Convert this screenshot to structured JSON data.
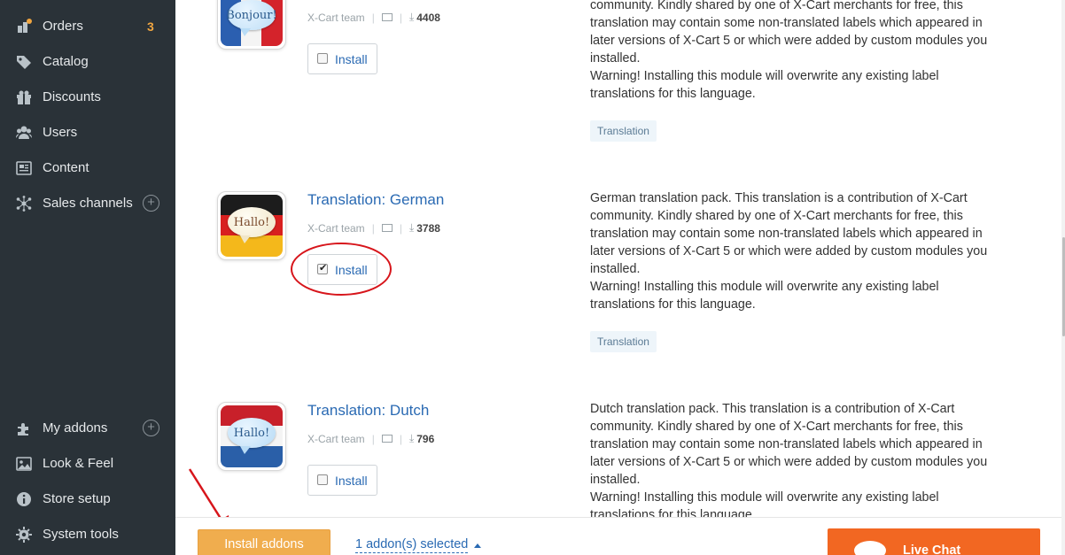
{
  "sidebar": {
    "items": [
      {
        "label": "Orders",
        "icon": "orders-icon",
        "count": "3"
      },
      {
        "label": "Catalog",
        "icon": "tag-icon"
      },
      {
        "label": "Discounts",
        "icon": "gift-icon"
      },
      {
        "label": "Users",
        "icon": "users-icon"
      },
      {
        "label": "Content",
        "icon": "newspaper-icon"
      },
      {
        "label": "Sales channels",
        "icon": "network-icon",
        "plus": "+"
      },
      {
        "label": "My addons",
        "icon": "puzzle-icon",
        "plus": "+"
      },
      {
        "label": "Look & Feel",
        "icon": "image-icon"
      },
      {
        "label": "Store setup",
        "icon": "info-icon"
      },
      {
        "label": "System tools",
        "icon": "gear-icon"
      }
    ],
    "orders_badge_color": "#f0a540"
  },
  "addons": [
    {
      "name": "",
      "tile_text": "Bonjour!",
      "author": "X-Cart team",
      "downloads": "4408",
      "install_label": "Install",
      "checked": false,
      "description": [
        "community. Kindly shared by one of X-Cart merchants for free, this",
        "translation may contain some non-translated labels which appeared in",
        "later versions of X-Cart 5 or which were added by custom modules you",
        "installed.",
        "Warning! Installing this module will overwrite any existing label",
        "translations for this language."
      ],
      "tag": "Translation"
    },
    {
      "name": "Translation: German",
      "tile_text": "Hallo!",
      "author": "X-Cart team",
      "downloads": "3788",
      "install_label": "Install",
      "checked": true,
      "description": [
        "German translation pack. This translation is a contribution of X-Cart",
        "community. Kindly shared by one of X-Cart merchants for free, this",
        "translation may contain some non-translated labels which appeared in",
        "later versions of X-Cart 5 or which were added by custom modules you",
        "installed.",
        "Warning! Installing this module will overwrite any existing label",
        "translations for this language."
      ],
      "tag": "Translation"
    },
    {
      "name": "Translation: Dutch",
      "tile_text": "Hallo!",
      "author": "X-Cart team",
      "downloads": "796",
      "install_label": "Install",
      "checked": false,
      "description": [
        "Dutch translation pack. This translation is a contribution of X-Cart",
        "community. Kindly shared by one of X-Cart merchants for free, this",
        "translation may contain some non-translated labels which appeared in",
        "later versions of X-Cart 5 or which were added by custom modules you",
        "installed.",
        "Warning! Installing this module will overwrite any existing label",
        "translations for this language."
      ]
    }
  ],
  "bottom_bar": {
    "install_button": "Install addons",
    "selected_text": "1 addon(s) selected",
    "live_chat": "Live Chat"
  },
  "colors": {
    "sidebar_bg": "#2a3238",
    "link": "#2a6ab3",
    "install_button": "#f0ad4e",
    "live_chat": "#f26722",
    "annotation_red": "#d7151b"
  }
}
